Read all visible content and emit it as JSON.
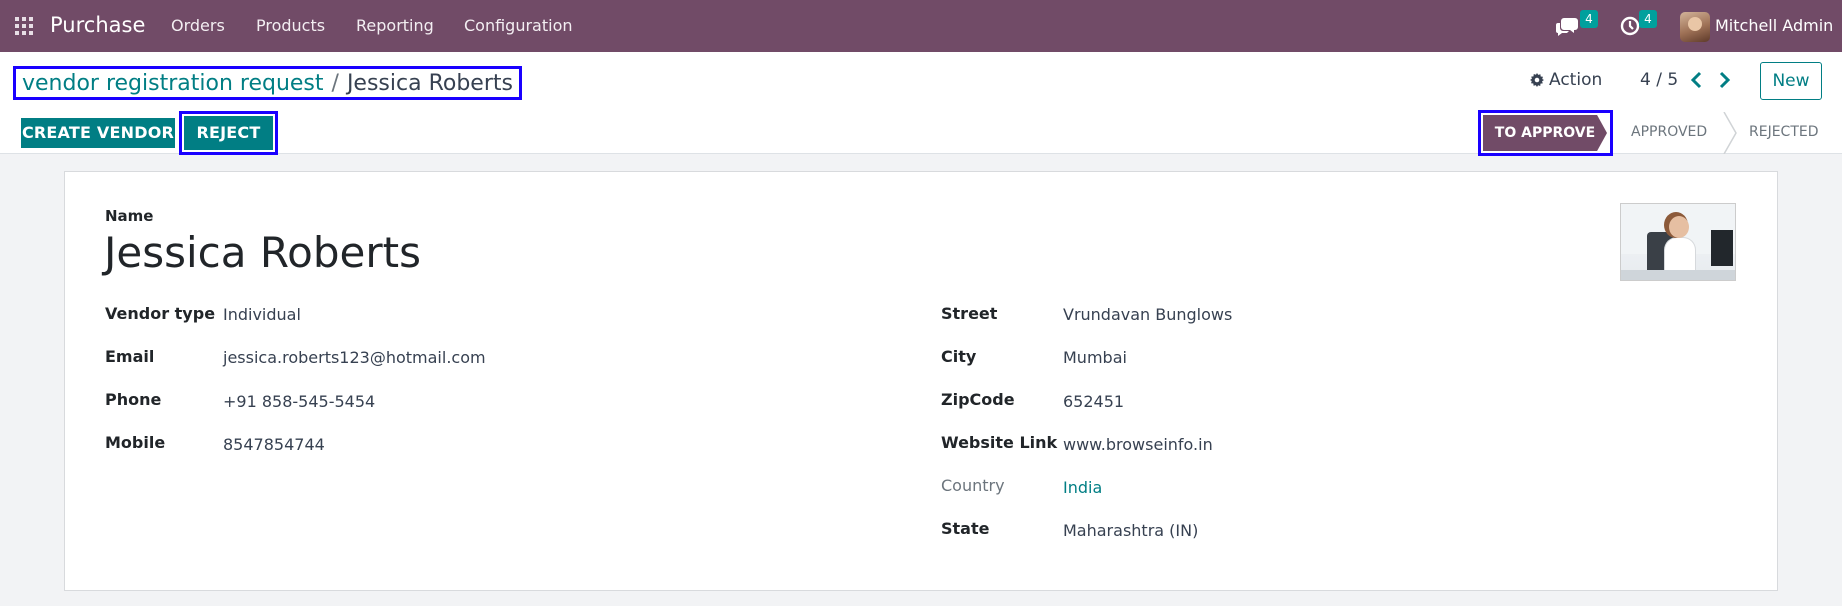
{
  "navbar": {
    "app_name": "Purchase",
    "menu": [
      "Orders",
      "Products",
      "Reporting",
      "Configuration"
    ],
    "messages_count": "4",
    "activities_count": "4",
    "user_name": "Mitchell Admin"
  },
  "breadcrumb": {
    "parent": "vendor registration request",
    "separator": "/",
    "current": "Jessica Roberts"
  },
  "toolbar": {
    "action_label": "Action",
    "pager": "4 / 5",
    "new_label": "New"
  },
  "buttons": {
    "create_vendor": "CREATE VENDOR",
    "reject": "REJECT"
  },
  "statusbar": {
    "steps": [
      "TO APPROVE",
      "APPROVED",
      "REJECTED"
    ],
    "current": "TO APPROVE"
  },
  "form": {
    "name_label": "Name",
    "name": "Jessica Roberts",
    "left_fields": [
      {
        "label": "Vendor type",
        "value": "Individual"
      },
      {
        "label": "Email",
        "value": "jessica.roberts123@hotmail.com"
      },
      {
        "label": "Phone",
        "value": "+91 858-545-5454"
      },
      {
        "label": "Mobile",
        "value": "8547854744"
      }
    ],
    "right_fields": [
      {
        "label": "Street",
        "value": "Vrundavan Bunglows"
      },
      {
        "label": "City",
        "value": "Mumbai"
      },
      {
        "label": "ZipCode",
        "value": "652451"
      },
      {
        "label": "Website Link",
        "value": "www.browseinfo.in"
      },
      {
        "label": "Country",
        "value": "India"
      },
      {
        "label": "State",
        "value": "Maharashtra (IN)"
      }
    ]
  },
  "colors": {
    "navbar": "#714b67",
    "primary": "#017e84",
    "highlight_border": "#1a00ff"
  }
}
